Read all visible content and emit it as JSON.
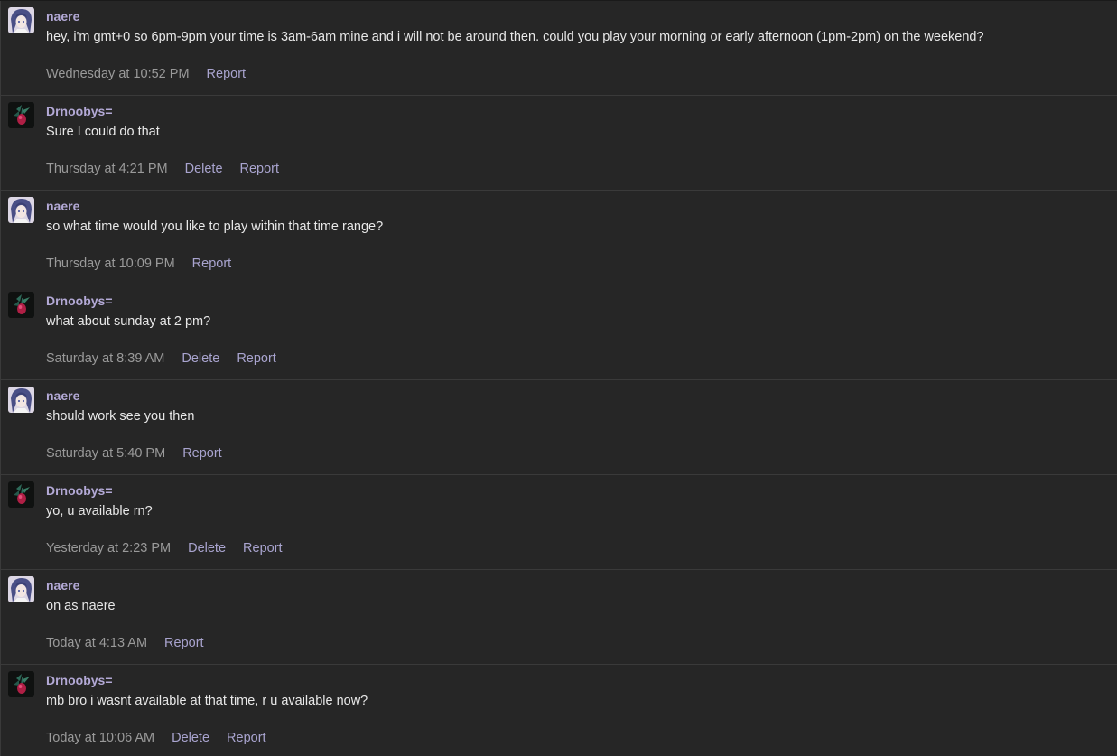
{
  "messages": [
    {
      "author": "naere",
      "avatar": "naere-avatar",
      "text": "hey, i'm gmt+0 so 6pm-9pm your time is 3am-6am mine and i will not be around then. could you play your morning or early afternoon (1pm-2pm) on the weekend?",
      "time": "Wednesday at 10:52 PM",
      "delete": "",
      "report": "Report"
    },
    {
      "author": "Drnoobys=",
      "avatar": "drnoobys-avatar",
      "text": "Sure I could do that",
      "time": "Thursday at 4:21 PM",
      "delete": "Delete",
      "report": "Report"
    },
    {
      "author": "naere",
      "avatar": "naere-avatar",
      "text": "so what time would you like to play within that time range?",
      "time": "Thursday at 10:09 PM",
      "delete": "",
      "report": "Report"
    },
    {
      "author": "Drnoobys=",
      "avatar": "drnoobys-avatar",
      "text": "what about sunday at 2 pm?",
      "time": "Saturday at 8:39 AM",
      "delete": "Delete",
      "report": "Report"
    },
    {
      "author": "naere",
      "avatar": "naere-avatar",
      "text": "should work see you then",
      "time": "Saturday at 5:40 PM",
      "delete": "",
      "report": "Report"
    },
    {
      "author": "Drnoobys=",
      "avatar": "drnoobys-avatar",
      "text": "yo, u available rn?",
      "time": "Yesterday at 2:23 PM",
      "delete": "Delete",
      "report": "Report"
    },
    {
      "author": "naere",
      "avatar": "naere-avatar",
      "text": "on as naere",
      "time": "Today at 4:13 AM",
      "delete": "",
      "report": "Report"
    },
    {
      "author": "Drnoobys=",
      "avatar": "drnoobys-avatar",
      "text": "mb bro i wasnt available at that time, r u available now?",
      "time": "Today at 10:06 AM",
      "delete": "Delete",
      "report": "Report"
    }
  ]
}
